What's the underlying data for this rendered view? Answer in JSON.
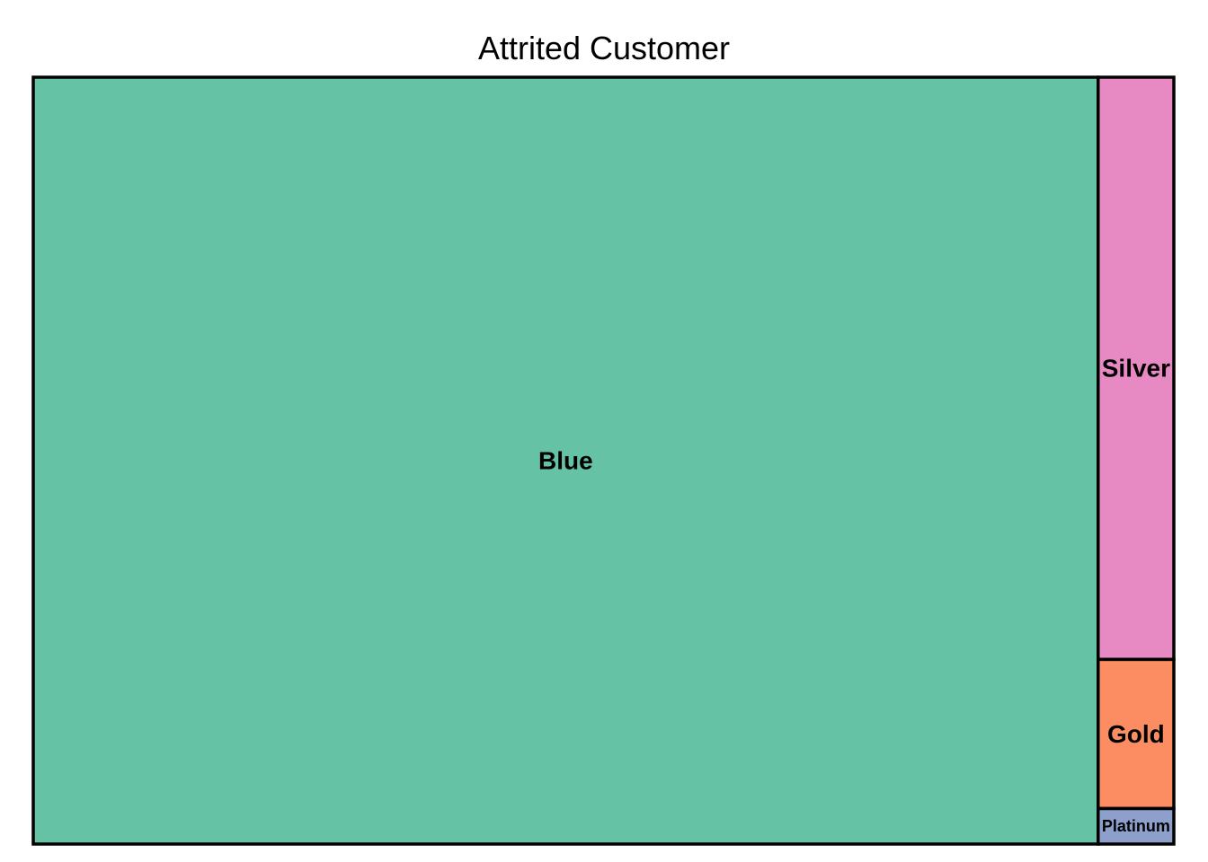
{
  "chart_data": {
    "type": "treemap",
    "title": "Attrited Customer",
    "categories": [
      "Blue",
      "Silver",
      "Gold",
      "Platinum"
    ],
    "values": [
      1519,
      82,
      21,
      5
    ],
    "colors": [
      "#66c2a5",
      "#e78ac3",
      "#fc8d62",
      "#8da0cb"
    ]
  }
}
